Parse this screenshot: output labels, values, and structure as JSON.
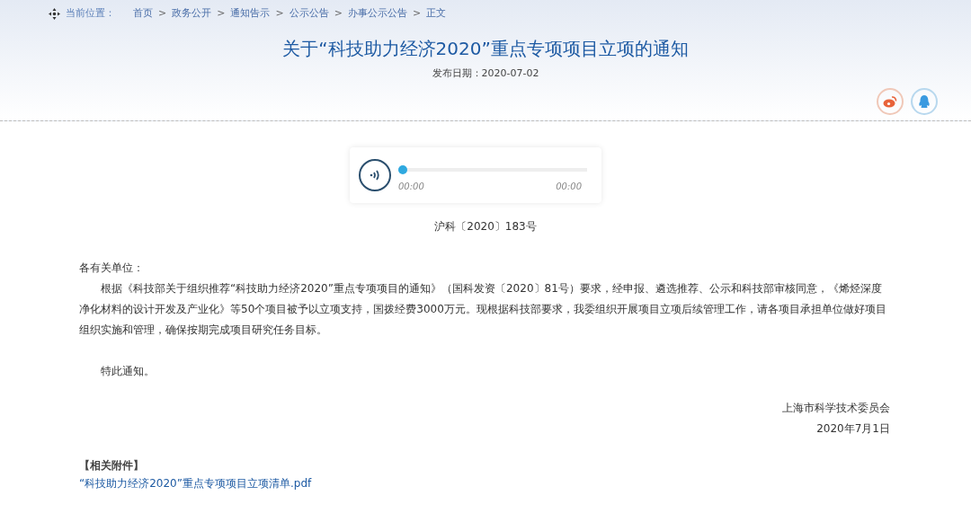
{
  "breadcrumb": {
    "label": "当前位置：",
    "items": [
      {
        "kind": "link",
        "text": "首页"
      },
      {
        "kind": "separator",
        "text": ">"
      },
      {
        "kind": "link",
        "text": "政务公开"
      },
      {
        "kind": "separator",
        "text": ">"
      },
      {
        "kind": "link",
        "text": "通知告示"
      },
      {
        "kind": "separator",
        "text": ">"
      },
      {
        "kind": "link",
        "text": "公示公告"
      },
      {
        "kind": "separator",
        "text": ">"
      },
      {
        "kind": "link",
        "text": "办事公示公告"
      },
      {
        "kind": "separator",
        "text": ">"
      },
      {
        "kind": "link",
        "text": "正文"
      }
    ]
  },
  "title": "关于“科技助力经济2020”重点专项项目立项的通知",
  "publish_date": "发布日期：2020-07-02",
  "share": [
    {
      "kind": "weibo"
    },
    {
      "kind": "qq"
    }
  ],
  "audio_player": {
    "level": 0,
    "current_time": "00:00",
    "duration": "00:00"
  },
  "document_number": "沪科〔2020〕183号",
  "salutation": "各有关单位：",
  "paragraphs": [
    "根据《科技部关于组织推荐“科技助力经济2020”重点专项项目的通知》（国科发资〔2020〕81号）要求，经申报、遴选推荐、公示和科技部审核同意，《烯烃深度净化材料的设计开发及产业化》等50个项目被予以立项支持，国拨经费3000万元。现根据科技部要求，我委组织开展项目立项后续管理工作，请各项目承担单位做好项目组织实施和管理，确保按期完成项目研究任务目标。",
    "特此通知。"
  ],
  "signature": {
    "organization": "上海市科学技术委员会",
    "date": "2020年7月1日"
  },
  "attachments": {
    "heading": "【相关附件】",
    "files": [
      "“科技助力经济2020”重点专项项目立项清单.pdf"
    ]
  }
}
